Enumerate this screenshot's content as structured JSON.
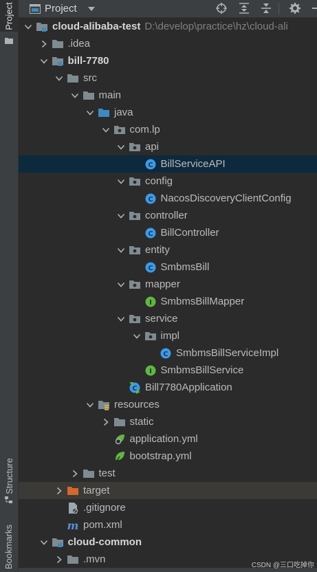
{
  "side_stripe": {
    "project_tab": "Project",
    "structure_tab": "Structure",
    "bookmarks_tab": "Bookmarks"
  },
  "header": {
    "title": "Project",
    "tools": [
      "locate-icon",
      "expand-all-icon",
      "collapse-all-icon",
      "gear-icon",
      "hide-icon"
    ]
  },
  "tree": [
    {
      "label": "cloud-alibaba-test",
      "path": "D:\\develop\\practice\\hz\\cloud-ali",
      "depth": 0,
      "arrow": "down",
      "icon": "module-folder",
      "bold": true
    },
    {
      "label": ".idea",
      "depth": 1,
      "arrow": "right",
      "icon": "folder"
    },
    {
      "label": "bill-7780",
      "depth": 1,
      "arrow": "down",
      "icon": "module-folder",
      "bold": true
    },
    {
      "label": "src",
      "depth": 2,
      "arrow": "down",
      "icon": "folder"
    },
    {
      "label": "main",
      "depth": 3,
      "arrow": "down",
      "icon": "folder"
    },
    {
      "label": "java",
      "depth": 4,
      "arrow": "down",
      "icon": "source-folder"
    },
    {
      "label": "com.lp",
      "depth": 5,
      "arrow": "down",
      "icon": "package"
    },
    {
      "label": "api",
      "depth": 6,
      "arrow": "down",
      "icon": "package"
    },
    {
      "label": "BillServiceAPI",
      "depth": 7,
      "icon": "class",
      "selected": true
    },
    {
      "label": "config",
      "depth": 6,
      "arrow": "down",
      "icon": "package"
    },
    {
      "label": "NacosDiscoveryClientConfig",
      "depth": 7,
      "icon": "class"
    },
    {
      "label": "controller",
      "depth": 6,
      "arrow": "down",
      "icon": "package"
    },
    {
      "label": "BillController",
      "depth": 7,
      "icon": "class"
    },
    {
      "label": "entity",
      "depth": 6,
      "arrow": "down",
      "icon": "package"
    },
    {
      "label": "SmbmsBill",
      "depth": 7,
      "icon": "class"
    },
    {
      "label": "mapper",
      "depth": 6,
      "arrow": "down",
      "icon": "package"
    },
    {
      "label": "SmbmsBillMapper",
      "depth": 7,
      "icon": "interface"
    },
    {
      "label": "service",
      "depth": 6,
      "arrow": "down",
      "icon": "package"
    },
    {
      "label": "impl",
      "depth": 7,
      "arrow": "down",
      "icon": "package"
    },
    {
      "label": "SmbmsBillServiceImpl",
      "depth": 8,
      "icon": "class"
    },
    {
      "label": "SmbmsBillService",
      "depth": 7,
      "icon": "interface"
    },
    {
      "label": "Bill7780Application",
      "depth": 6,
      "icon": "spring-app"
    },
    {
      "label": "resources",
      "depth": 4,
      "arrow": "down",
      "icon": "resources-folder"
    },
    {
      "label": "static",
      "depth": 5,
      "arrow": "right",
      "icon": "folder"
    },
    {
      "label": "application.yml",
      "depth": 5,
      "icon": "spring-config"
    },
    {
      "label": "bootstrap.yml",
      "depth": 5,
      "icon": "spring-config-leaf"
    },
    {
      "label": "test",
      "depth": 3,
      "arrow": "right",
      "icon": "folder"
    },
    {
      "label": "target",
      "depth": 2,
      "arrow": "right",
      "icon": "excluded-folder",
      "dim": true
    },
    {
      "label": ".gitignore",
      "depth": 2,
      "icon": "gitignore-file"
    },
    {
      "label": "pom.xml",
      "depth": 2,
      "icon": "maven-file"
    },
    {
      "label": "cloud-common",
      "depth": 1,
      "arrow": "down",
      "icon": "module-folder",
      "bold": true
    },
    {
      "label": ".mvn",
      "depth": 2,
      "arrow": "right",
      "icon": "folder"
    }
  ],
  "watermark": "CSDN @三口吃掉你",
  "colors": {
    "background": "#2b2b2b",
    "selected_row": "#0d293e",
    "folder": "#7f8b91",
    "source_folder": "#3d8ac0",
    "class": "#3d9be9",
    "interface": "#62b543",
    "excluded": "#d5682b"
  }
}
